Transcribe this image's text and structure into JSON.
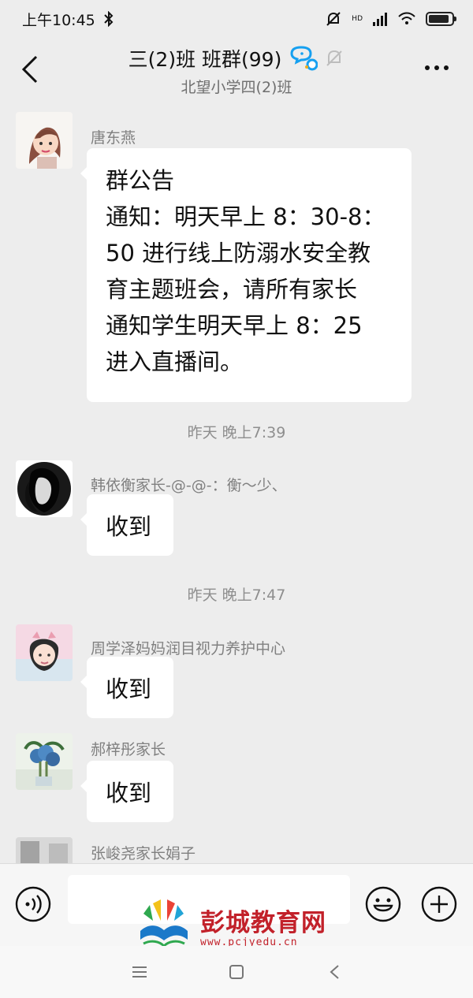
{
  "status_bar": {
    "time": "上午10:45",
    "signal_label": "HD"
  },
  "header": {
    "title": "三(2)班  班群(99)",
    "subtitle": "北望小学四(2)班"
  },
  "messages": [
    {
      "sender": "唐东燕",
      "title": "群公告",
      "body": "通知：明天早上 8：30-8：\n50 进行线上防溺水安全教\n育主题班会，请所有家长\n通知学生明天早上 8：25\n进入直播间。"
    },
    {
      "timestamp": "昨天 晚上7:39"
    },
    {
      "sender": "韩依衡家长-@-@-：衡～少、",
      "text": "收到"
    },
    {
      "timestamp": "昨天 晚上7:47"
    },
    {
      "sender": "周学泽妈妈润目视力养护中心",
      "text": "收到"
    },
    {
      "sender": "郝梓彤家长",
      "text": "收到"
    },
    {
      "sender": "张峻尧家长娟子"
    }
  ],
  "watermark": {
    "title": "彭城教育网",
    "url": "www.pcjyedu.cn"
  },
  "icons": {
    "back": "chevron-left-icon",
    "group_tag": "chat-bubbles-icon",
    "mute": "bell-off-icon",
    "more": "more-dots-icon",
    "voice": "voice-icon",
    "emoji": "emoji-icon",
    "plus": "plus-icon"
  }
}
